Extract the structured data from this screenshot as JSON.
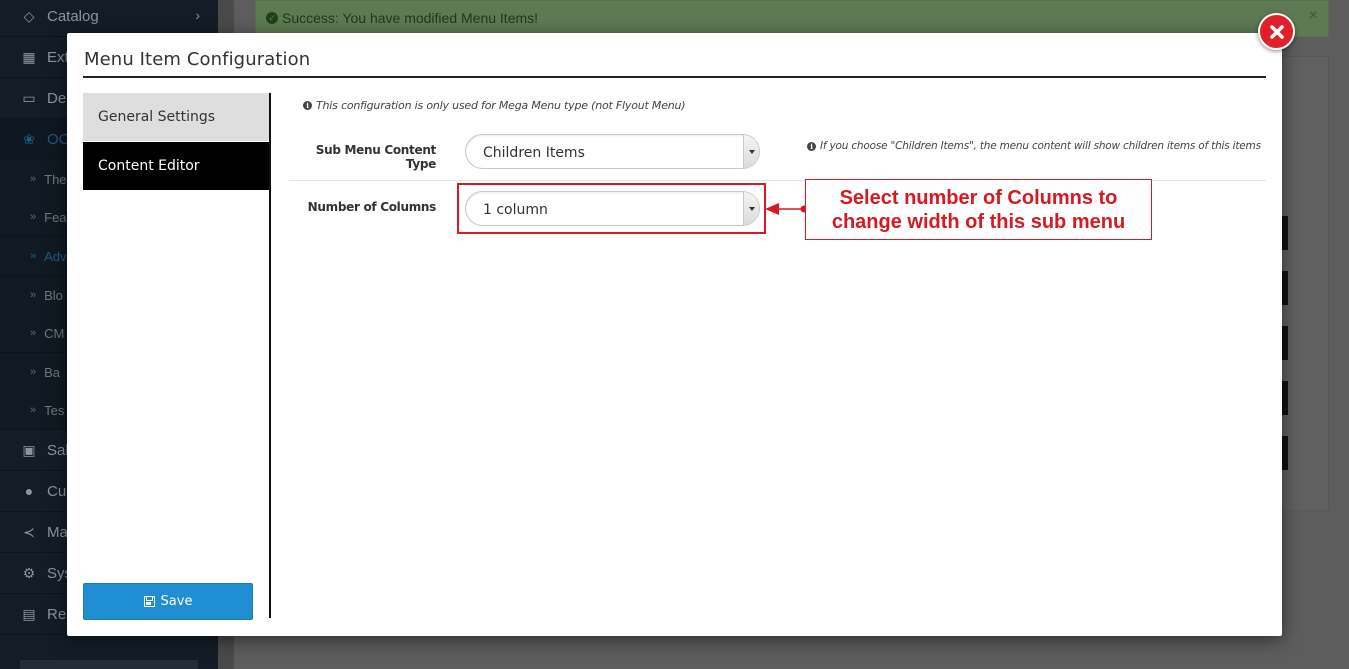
{
  "background": {
    "sidebar": {
      "items": [
        {
          "label": "Catalog",
          "icon": "tags-icon",
          "has_chevron": true
        },
        {
          "label": "Ext",
          "icon": "puzzle-icon"
        },
        {
          "label": "De",
          "icon": "desktop-icon"
        },
        {
          "label": "OC",
          "icon": "gear-circle-icon",
          "active": true
        },
        {
          "label": "Sal",
          "icon": "cart-icon"
        },
        {
          "label": "Cu",
          "icon": "user-icon"
        },
        {
          "label": "Ma",
          "icon": "share-icon"
        },
        {
          "label": "Sys",
          "icon": "cog-icon"
        },
        {
          "label": "Re",
          "icon": "bar-chart-icon"
        }
      ],
      "subitems": [
        {
          "label": "The"
        },
        {
          "label": "Fea"
        },
        {
          "label": "Adv",
          "active": true
        },
        {
          "label": "Blo"
        },
        {
          "label": "CM"
        },
        {
          "label": "Ba"
        },
        {
          "label": "Tes"
        }
      ]
    },
    "alert": {
      "message": "Success: You have modified Menu Items!",
      "close_glyph": "×"
    }
  },
  "modal": {
    "title": "Menu Item Configuration",
    "tabs": [
      {
        "label": "General Settings",
        "active": false
      },
      {
        "label": "Content Editor",
        "active": true
      }
    ],
    "save_label": "Save",
    "info_note": "This configuration is only used for Mega Menu type (not Flyout Menu)",
    "fields": {
      "sub_menu_content_type": {
        "label": "Sub Menu Content Type",
        "value": "Children Items",
        "help": "If you choose \"Children Items\", the menu content will show children items of this items"
      },
      "number_of_columns": {
        "label": "Number of Columns",
        "value": "1 column"
      }
    },
    "annotation": {
      "text": "Select number of Columns to change width of this sub menu",
      "color": "#d71920"
    }
  },
  "colors": {
    "primary_button": "#1f8ed3",
    "close_button": "#e1202a",
    "active_tab": "#000000",
    "inactive_tab": "#dedede"
  }
}
